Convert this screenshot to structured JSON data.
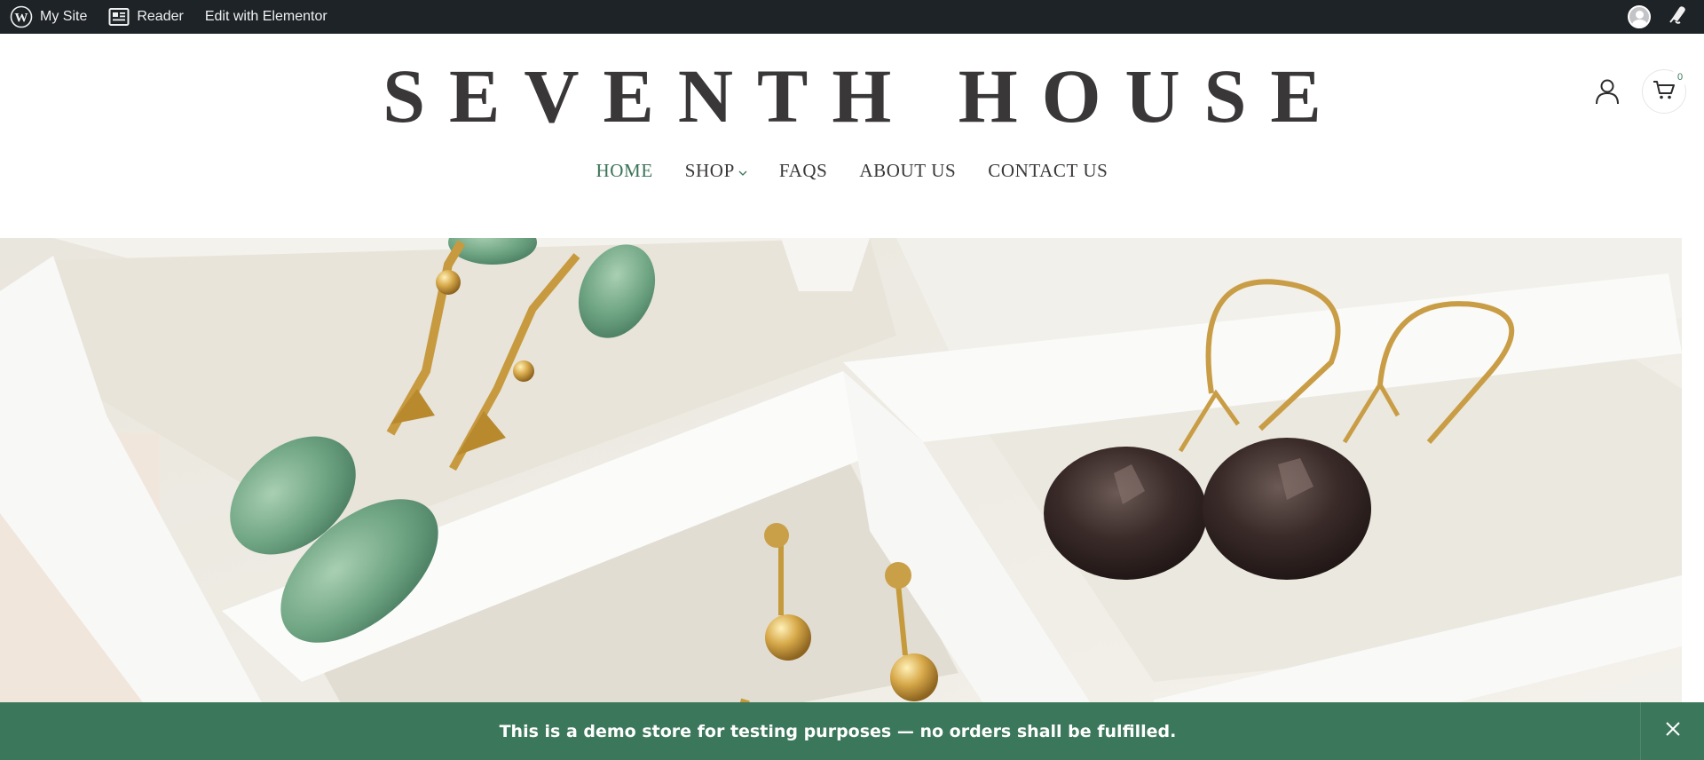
{
  "adminbar": {
    "my_site": "My Site",
    "reader": "Reader",
    "edit": "Edit with Elementor"
  },
  "header": {
    "site_title": "SEVENTH HOUSE",
    "nav": [
      "HOME",
      "SHOP",
      "FAQS",
      "ABOUT US",
      "CONTACT US"
    ],
    "active_nav": "HOME",
    "cart_count": "0"
  },
  "hero": {
    "description": "Jewelry tray with green drop earrings, gold ball studs and smoky quartz earrings"
  },
  "notice": {
    "text": "This is a demo store for testing purposes — no orders shall be fulfilled."
  },
  "icons": {
    "adminbar": [
      "wordpress-icon",
      "reader-icon",
      "avatar-icon",
      "notifications-icon"
    ],
    "header": [
      "account-icon",
      "cart-icon"
    ],
    "notice": [
      "close-icon"
    ]
  },
  "colors": {
    "adminbar_bg": "#1d2327",
    "title_text": "#3a3738",
    "accent_green": "#3b775a",
    "notice_bg": "#3b775a"
  }
}
